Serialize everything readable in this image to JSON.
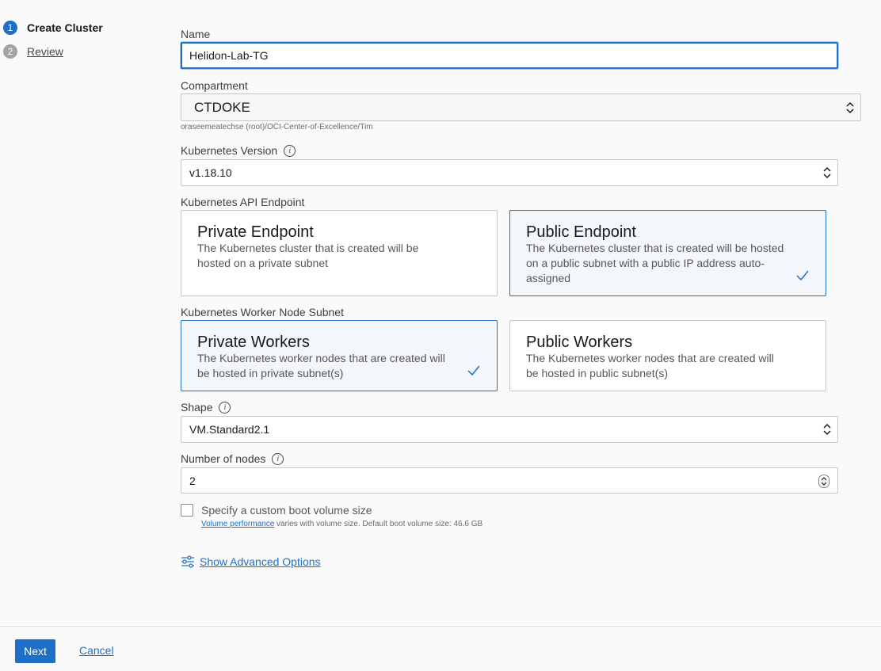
{
  "steps": [
    {
      "num": "1",
      "label": "Create Cluster"
    },
    {
      "num": "2",
      "label": "Review"
    }
  ],
  "form": {
    "name_label": "Name",
    "name_value": "Helidon-Lab-TG",
    "compartment_label": "Compartment",
    "compartment_value": "CTDOKE",
    "compartment_path": "oraseemeatechse (root)/OCI-Center-of-Excellence/Tim",
    "k8s_version_label": "Kubernetes Version",
    "k8s_version_value": "v1.18.10",
    "api_endpoint_label": "Kubernetes API Endpoint",
    "api_options": [
      {
        "title": "Private Endpoint",
        "desc": "The Kubernetes cluster that is created will be hosted on a private subnet",
        "selected": false
      },
      {
        "title": "Public Endpoint",
        "desc": "The Kubernetes cluster that is created will be hosted on a public subnet with a public IP address auto-assigned",
        "selected": true
      }
    ],
    "worker_subnet_label": "Kubernetes Worker Node Subnet",
    "worker_options": [
      {
        "title": "Private Workers",
        "desc": "The Kubernetes worker nodes that are created will be hosted in private subnet(s)",
        "selected": true
      },
      {
        "title": "Public Workers",
        "desc": "The Kubernetes worker nodes that are created will be hosted in public subnet(s)",
        "selected": false
      }
    ],
    "shape_label": "Shape",
    "shape_value": "VM.Standard2.1",
    "nodes_label": "Number of nodes",
    "nodes_value": "2",
    "boot_volume_label": "Specify a custom boot volume size",
    "boot_volume_checked": false,
    "volume_link": "Volume performance",
    "volume_help": " varies with volume size. Default boot volume size: 46.6 GB",
    "advanced_label": "Show Advanced Options"
  },
  "footer": {
    "next_label": "Next",
    "cancel_label": "Cancel"
  },
  "colors": {
    "accent": "#1d6fc8",
    "selected_bg": "#f3f7fb"
  }
}
